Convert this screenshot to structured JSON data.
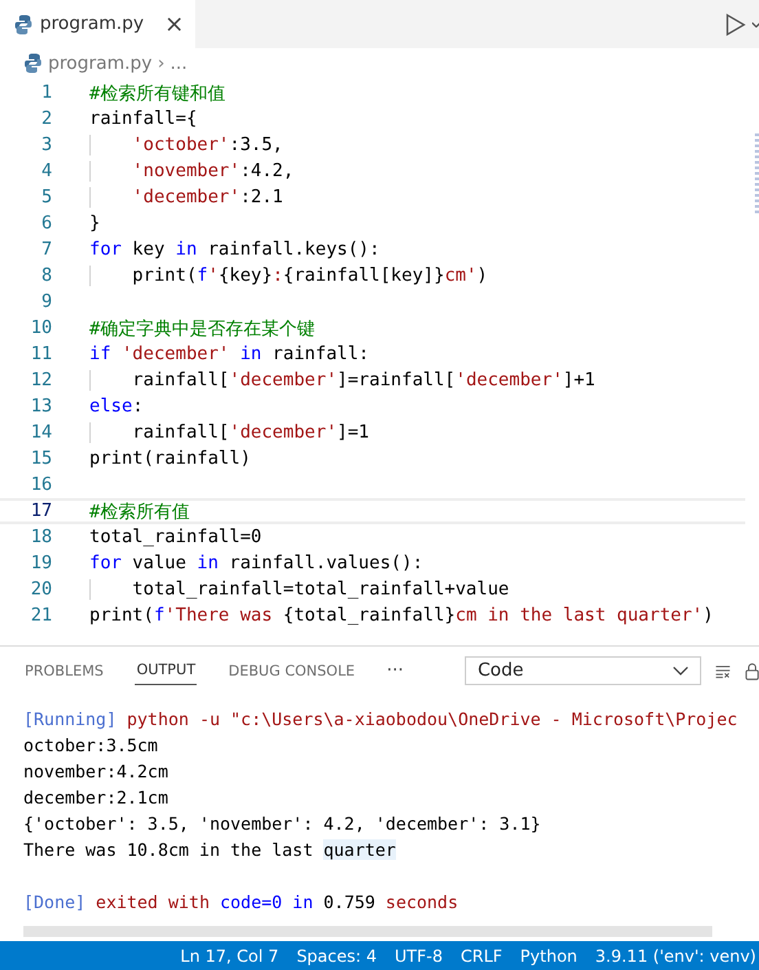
{
  "tabs": [
    {
      "label": "program.py",
      "selected": true,
      "close": "×"
    }
  ],
  "breadcrumb": {
    "file": "program.py",
    "separator": "›",
    "rest": "..."
  },
  "editor": {
    "lines": [
      {
        "number": "1",
        "current": false,
        "tokens": [
          {
            "kind": "comment",
            "text": "#检索所有键和值"
          }
        ]
      },
      {
        "number": "2",
        "current": false,
        "tokens": [
          {
            "kind": "plain",
            "text": "rainfall={"
          }
        ]
      },
      {
        "number": "3",
        "current": false,
        "tokens": [
          {
            "kind": "string",
            "text": "    'october'"
          },
          {
            "kind": "plain",
            "text": ":3.5,"
          }
        ]
      },
      {
        "number": "4",
        "current": false,
        "tokens": [
          {
            "kind": "string",
            "text": "    'november'"
          },
          {
            "kind": "plain",
            "text": ":4.2,"
          }
        ]
      },
      {
        "number": "5",
        "current": false,
        "tokens": [
          {
            "kind": "string",
            "text": "    'december'"
          },
          {
            "kind": "plain",
            "text": ":2.1"
          }
        ]
      },
      {
        "number": "6",
        "current": false,
        "tokens": [
          {
            "kind": "plain",
            "text": "}"
          }
        ]
      },
      {
        "number": "7",
        "current": false,
        "tokens": [
          {
            "kind": "keyword",
            "text": "for"
          },
          {
            "kind": "plain",
            "text": " key "
          },
          {
            "kind": "keyword",
            "text": "in"
          },
          {
            "kind": "plain",
            "text": " rainfall.keys():"
          }
        ]
      },
      {
        "number": "8",
        "current": false,
        "tokens": [
          {
            "kind": "plain",
            "text": "    print("
          },
          {
            "kind": "keyword",
            "text": "f"
          },
          {
            "kind": "string",
            "text": "'"
          },
          {
            "kind": "plain",
            "text": "{key}"
          },
          {
            "kind": "string",
            "text": ":"
          },
          {
            "kind": "plain",
            "text": "{rainfall[key]}"
          },
          {
            "kind": "string",
            "text": "cm'"
          },
          {
            "kind": "plain",
            "text": ")"
          }
        ]
      },
      {
        "number": "9",
        "current": false
      },
      {
        "number": "10",
        "current": false,
        "tokens": [
          {
            "kind": "comment",
            "text": "#确定字典中是否存在某个键"
          }
        ]
      },
      {
        "number": "11",
        "current": false,
        "tokens": [
          {
            "kind": "keyword",
            "text": "if"
          },
          {
            "kind": "string",
            "text": " 'december'"
          },
          {
            "kind": "keyword",
            "text": " in"
          },
          {
            "kind": "plain",
            "text": " rainfall:"
          }
        ]
      },
      {
        "number": "12",
        "current": false,
        "tokens": [
          {
            "kind": "plain",
            "text": "    rainfall["
          },
          {
            "kind": "string",
            "text": "'december'"
          },
          {
            "kind": "plain",
            "text": "]=rainfall["
          },
          {
            "kind": "string",
            "text": "'december'"
          },
          {
            "kind": "plain",
            "text": "]+1"
          }
        ]
      },
      {
        "number": "13",
        "current": false,
        "tokens": [
          {
            "kind": "keyword",
            "text": "else"
          },
          {
            "kind": "plain",
            "text": ":"
          }
        ]
      },
      {
        "number": "14",
        "current": false,
        "tokens": [
          {
            "kind": "plain",
            "text": "    rainfall["
          },
          {
            "kind": "string",
            "text": "'december'"
          },
          {
            "kind": "plain",
            "text": "]=1"
          }
        ]
      },
      {
        "number": "15",
        "current": false,
        "tokens": [
          {
            "kind": "plain",
            "text": "print(rainfall)"
          }
        ]
      },
      {
        "number": "16",
        "current": false
      },
      {
        "number": "17",
        "current": true,
        "tokens": [
          {
            "kind": "comment",
            "text": "#检索所有值"
          }
        ]
      },
      {
        "number": "18",
        "current": false,
        "tokens": [
          {
            "kind": "plain",
            "text": "total_rainfall=0"
          }
        ]
      },
      {
        "number": "19",
        "current": false,
        "tokens": [
          {
            "kind": "keyword",
            "text": "for"
          },
          {
            "kind": "plain",
            "text": " value "
          },
          {
            "kind": "keyword",
            "text": "in"
          },
          {
            "kind": "plain",
            "text": " rainfall.values():"
          }
        ]
      },
      {
        "number": "20",
        "current": false,
        "tokens": [
          {
            "kind": "plain",
            "text": "    total_rainfall=total_rainfall+value"
          }
        ]
      },
      {
        "number": "21",
        "current": false,
        "tokens": [
          {
            "kind": "plain",
            "text": "print("
          },
          {
            "kind": "keyword",
            "text": "f"
          },
          {
            "kind": "string",
            "text": "'There was "
          },
          {
            "kind": "plain",
            "text": "{total_rainfall}"
          },
          {
            "kind": "string",
            "text": "cm in the last quarter'"
          },
          {
            "kind": "plain",
            "text": ")"
          }
        ]
      }
    ]
  },
  "panel": {
    "tabs": [
      {
        "label": "PROBLEMS",
        "selected": false
      },
      {
        "label": "OUTPUT",
        "selected": true
      },
      {
        "label": "DEBUG CONSOLE",
        "selected": false
      }
    ],
    "more": "···",
    "channel": "Code",
    "output": [
      {
        "kind": "text",
        "tokens": [
          {
            "kind": "info",
            "text": "[Running]"
          },
          {
            "kind": "string",
            "text": " python -u \"c:\\Users\\a-xiaobodou\\OneDrive - Microsoft\\Projec"
          }
        ]
      },
      {
        "kind": "text",
        "tokens": [
          {
            "kind": "plain",
            "text": "october:3.5cm"
          }
        ]
      },
      {
        "kind": "text",
        "tokens": [
          {
            "kind": "plain",
            "text": "november:4.2cm"
          }
        ]
      },
      {
        "kind": "text",
        "tokens": [
          {
            "kind": "plain",
            "text": "december:2.1cm"
          }
        ]
      },
      {
        "kind": "text",
        "tokens": [
          {
            "kind": "plain",
            "text": "{'october': 3.5, 'november': 4.2, 'december': 3.1}"
          }
        ]
      },
      {
        "kind": "text",
        "tokens": [
          {
            "kind": "plain",
            "text": "There was 10.8cm in the last "
          },
          {
            "kind": "match",
            "text": "quarter"
          }
        ]
      },
      {
        "kind": "blank"
      },
      {
        "kind": "text",
        "tokens": [
          {
            "kind": "info",
            "text": "[Done]"
          },
          {
            "kind": "string",
            "text": " exited with "
          },
          {
            "kind": "keyword",
            "text": "code=0 in "
          },
          {
            "kind": "plain",
            "text": "0.759"
          },
          {
            "kind": "string",
            "text": " seconds"
          }
        ]
      }
    ]
  },
  "status_bar": [
    "Ln 17, Col 7",
    "Spaces: 4",
    "UTF-8",
    "CRLF",
    "Python",
    "3.9.11 ('env': venv)"
  ]
}
